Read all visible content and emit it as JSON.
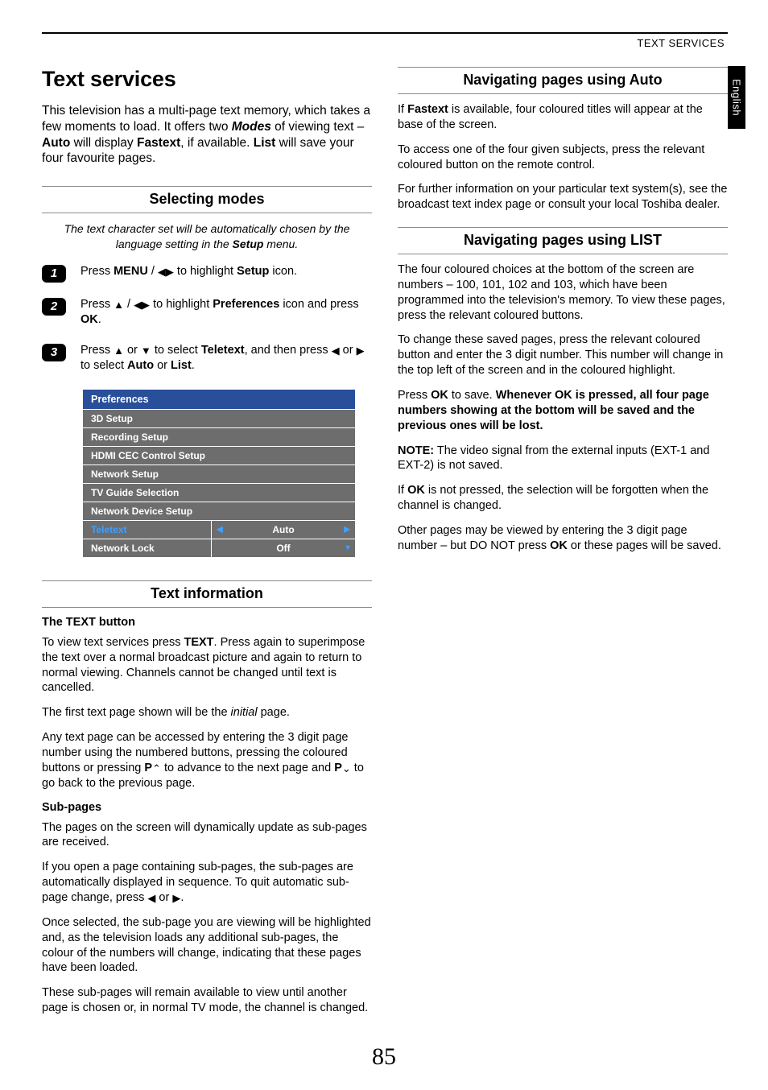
{
  "header": {
    "section": "TEXT SERVICES",
    "language_tab": "English"
  },
  "page_number": "85",
  "left": {
    "title": "Text services",
    "intro_html": "This television has a multi-page text memory, which takes a few moments to load. It offers two <b><i>Modes</i></b> of viewing text – <b>Auto</b> will display <b>Fastext</b>, if available. <b>List</b> will save your four favourite pages.",
    "selecting_head": "Selecting modes",
    "selecting_note_html": "The text character set will be automatically chosen by the language setting in the <b>Setup</b> menu.",
    "steps": [
      {
        "n": "1",
        "html": "Press <b>MENU</b> / <span class='icon' data-name='left-right-icon' data-interactable='false'>◀▶</span> to highlight <b>Setup</b> icon."
      },
      {
        "n": "2",
        "html": "Press <span class='icon' data-name='up-icon' data-interactable='false'>▲</span> / <span class='icon' data-name='left-right-icon' data-interactable='false'>◀▶</span> to highlight <b>Preferences</b> icon and press <b>OK</b>."
      },
      {
        "n": "3",
        "html": "Press <span class='icon' data-name='up-icon' data-interactable='false'>▲</span> or <span class='icon' data-name='down-icon' data-interactable='false'>▼</span> to select <b>Teletext</b>, and then press <span class='icon' data-name='left-icon' data-interactable='false'>◀</span> or <span class='icon' data-name='right-icon' data-interactable='false'>▶</span> to select <b>Auto</b> or <b>List</b>."
      }
    ],
    "menu": {
      "header": "Preferences",
      "rows": [
        {
          "label": "3D Setup",
          "value": "",
          "hl": false,
          "arrows": ""
        },
        {
          "label": "Recording Setup",
          "value": "",
          "hl": false,
          "arrows": ""
        },
        {
          "label": "HDMI CEC Control Setup",
          "value": "",
          "hl": false,
          "arrows": ""
        },
        {
          "label": "Network Setup",
          "value": "",
          "hl": false,
          "arrows": ""
        },
        {
          "label": "TV Guide Selection",
          "value": "",
          "hl": false,
          "arrows": ""
        },
        {
          "label": "Network Device Setup",
          "value": "",
          "hl": false,
          "arrows": ""
        },
        {
          "label": "Teletext",
          "value": "Auto",
          "hl": true,
          "arrows": "lr"
        },
        {
          "label": "Network Lock",
          "value": "Off",
          "hl": false,
          "arrows": "d"
        }
      ]
    },
    "textinfo_head": "Text information",
    "textinfo": {
      "sub1": "The TEXT button",
      "p1_html": "To view text services press <b>TEXT</b>. Press again to superimpose the text over a normal broadcast picture and again to return to normal viewing. Channels cannot be changed until text is cancelled.",
      "p2_html": "The first text page shown will be the <i>initial</i> page.",
      "p3_html": "Any text page can be accessed by entering the 3 digit page number using the numbered buttons, pressing the coloured buttons or pressing <b>P</b><span class='icon' data-name='page-up-icon' data-interactable='false'>&#8963;</span> to advance to the next page and <b>P</b><span class='icon' data-name='page-down-icon' data-interactable='false'>&#8964;</span> to go back to the previous page.",
      "sub2": "Sub-pages",
      "p4": "The pages on the screen will dynamically update as sub-pages are received.",
      "p5_html": "If you open a page containing sub-pages, the sub-pages are automatically displayed in sequence. To quit automatic sub-page change, press <span class='icon' data-name='left-icon' data-interactable='false'>◀</span> or <span class='icon' data-name='right-icon' data-interactable='false'>▶</span>.",
      "p6": "Once selected, the sub-page you are viewing will be highlighted and, as the television loads any additional sub-pages, the colour of the numbers will change, indicating that these pages have been loaded.",
      "p7": "These sub-pages will remain available to view until another page is chosen or, in normal TV mode, the channel is changed."
    }
  },
  "right": {
    "auto_head": "Navigating pages using Auto",
    "auto": {
      "p1_html": "If <b>Fastext</b> is available, four coloured titles will appear at the base of the screen.",
      "p2": "To access one of the four given subjects, press the relevant coloured button on the remote control.",
      "p3": "For further information on your particular text system(s), see the broadcast text index page or consult your local Toshiba dealer."
    },
    "list_head": "Navigating pages using LIST",
    "list": {
      "p1": "The four coloured choices at the bottom of the screen are numbers – 100, 101, 102 and 103, which have been programmed into the television's memory. To view these pages, press the relevant coloured buttons.",
      "p2": "To change these saved pages, press the relevant coloured button and enter the 3 digit number. This number will change in the top left of the screen and in the coloured highlight.",
      "p3_html": "Press <b>OK</b> to save. <b>Whenever OK is pressed, all four page numbers showing at the bottom will be saved and the previous ones will be lost.</b>",
      "p4_html": "<b>NOTE:</b> The video signal from the external inputs (EXT-1 and EXT-2) is not saved.",
      "p5_html": "If <b>OK</b> is not pressed, the selection will be forgotten when the channel is changed.",
      "p6_html": "Other pages may be viewed by entering the 3 digit page number – but DO NOT press <b>OK</b> or these pages will be saved."
    }
  }
}
